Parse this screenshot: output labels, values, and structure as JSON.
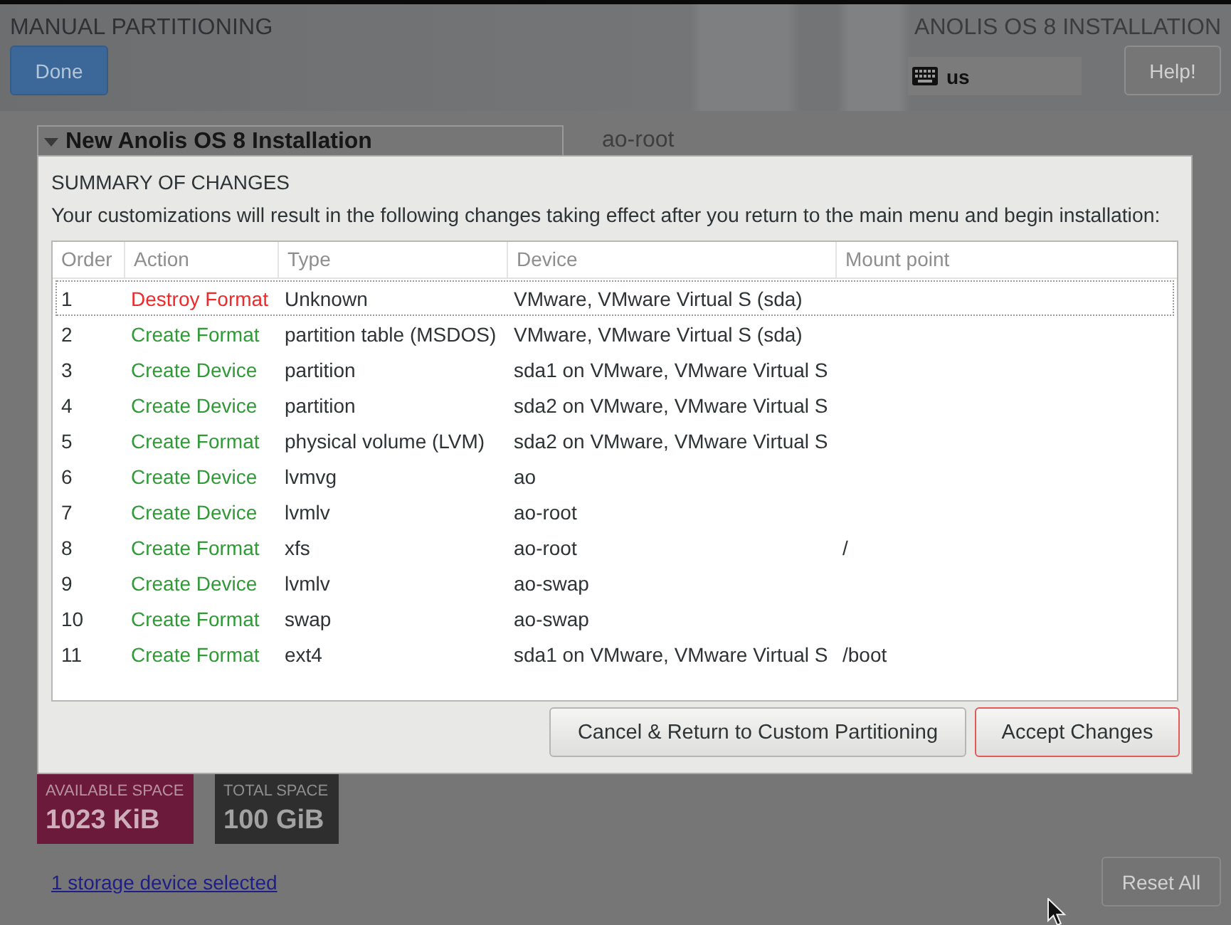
{
  "window": {
    "title": "MANUAL PARTITIONING",
    "product": "ANOLIS OS 8 INSTALLATION"
  },
  "header": {
    "done_button": "Done",
    "keyboard_layout": "us",
    "help_button": "Help!"
  },
  "background_page": {
    "panel": {
      "title": "New Anolis OS 8 Installation",
      "expanded": true
    },
    "selected_device": "ao-root",
    "available_space": {
      "label": "AVAILABLE SPACE",
      "value": "1023 KiB"
    },
    "total_space": {
      "label": "TOTAL SPACE",
      "value": "100 GiB"
    },
    "storage_link": "1 storage device selected",
    "reset_button": "Reset All"
  },
  "dialog": {
    "title": "SUMMARY OF CHANGES",
    "description": "Your customizations will result in the following changes taking effect after you return to the main menu and begin installation:",
    "table": {
      "columns": [
        "Order",
        "Action",
        "Type",
        "Device",
        "Mount point"
      ],
      "rows": [
        {
          "order": "1",
          "action": "Destroy Format",
          "kind": "destroy",
          "type": "Unknown",
          "device": "VMware, VMware Virtual S (sda)",
          "selected": true
        },
        {
          "order": "2",
          "action": "Create Format",
          "kind": "create",
          "type": "partition table (MSDOS)",
          "device": "VMware, VMware Virtual S (sda)",
          "selected": false
        },
        {
          "order": "3",
          "action": "Create Device",
          "kind": "create",
          "type": "partition",
          "device": "sda1 on VMware, VMware Virtual S",
          "selected": false
        },
        {
          "order": "4",
          "action": "Create Device",
          "kind": "create",
          "type": "partition",
          "device": "sda2 on VMware, VMware Virtual S",
          "selected": false
        },
        {
          "order": "5",
          "action": "Create Format",
          "kind": "create",
          "type": "physical volume (LVM)",
          "device": "sda2 on VMware, VMware Virtual S",
          "selected": false
        },
        {
          "order": "6",
          "action": "Create Device",
          "kind": "create",
          "type": "lvmvg",
          "device": "ao",
          "selected": false
        },
        {
          "order": "7",
          "action": "Create Device",
          "kind": "create",
          "type": "lvmlv",
          "device": "ao-root",
          "selected": false
        },
        {
          "order": "8",
          "action": "Create Format",
          "kind": "create",
          "type": "xfs",
          "device": "ao-root",
          "mount_point": "/",
          "selected": false
        },
        {
          "order": "9",
          "action": "Create Device",
          "kind": "create",
          "type": "lvmlv",
          "device": "ao-swap",
          "selected": false
        },
        {
          "order": "10",
          "action": "Create Format",
          "kind": "create",
          "type": "swap",
          "device": "ao-swap",
          "selected": false
        },
        {
          "order": "11",
          "action": "Create Format",
          "kind": "create",
          "type": "ext4",
          "device": "sda1 on VMware, VMware Virtual S",
          "mount_point": "/boot",
          "selected": false
        }
      ]
    },
    "buttons": [
      {
        "label": "Cancel & Return to Custom Partitioning",
        "focused": false
      },
      {
        "label": "Accept Changes",
        "focused": true
      }
    ]
  }
}
